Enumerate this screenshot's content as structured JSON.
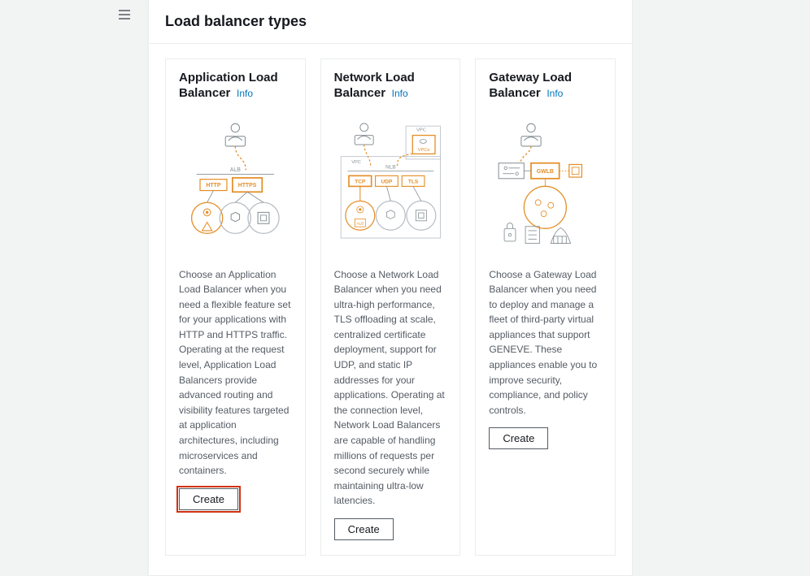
{
  "header": {
    "title": "Load balancer types"
  },
  "info_label": "Info",
  "cards": [
    {
      "title": "Application Load Balancer",
      "description": "Choose an Application Load Balancer when you need a flexible feature set for your applications with HTTP and HTTPS traffic. Operating at the request level, Application Load Balancers provide advanced routing and visibility features targeted at application architectures, including microservices and containers.",
      "create_label": "Create"
    },
    {
      "title": "Network Load Balancer",
      "description": "Choose a Network Load Balancer when you need ultra-high performance, TLS offloading at scale, centralized certificate deployment, support for UDP, and static IP addresses for your applications. Operating at the connection level, Network Load Balancers are capable of handling millions of requests per second securely while maintaining ultra-low latencies.",
      "create_label": "Create"
    },
    {
      "title": "Gateway Load Balancer",
      "description": "Choose a Gateway Load Balancer when you need to deploy and manage a fleet of third-party virtual appliances that support GENEVE. These appliances enable you to improve security, compliance, and policy controls.",
      "create_label": "Create"
    }
  ],
  "diagram_labels": {
    "alb": "ALB",
    "http": "HTTP",
    "https": "HTTPS",
    "nlb": "NLB",
    "tcp": "TCP",
    "udp": "UDP",
    "tls": "TLS",
    "vpc": "VPC",
    "vpce": "VPCe",
    "gwlb": "GWLB"
  }
}
